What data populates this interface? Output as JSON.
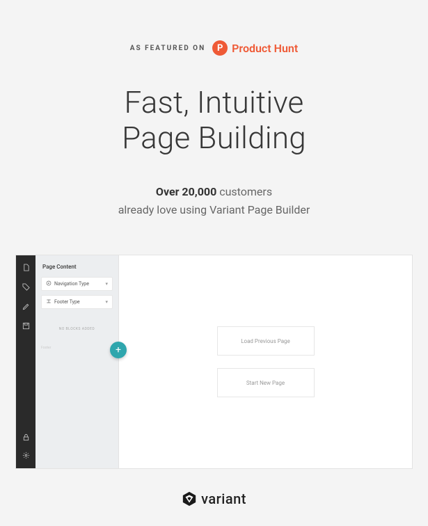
{
  "featured": {
    "label": "AS FEATURED ON",
    "ph_letter": "P",
    "ph_name": "Product Hunt"
  },
  "hero": {
    "line1": "Fast, Intuitive",
    "line2": "Page Building"
  },
  "subhead": {
    "strong": "Over 20,000",
    "rest1": " customers",
    "line2": "already love using Variant Page Builder"
  },
  "mockup": {
    "sidebar_title": "Page Content",
    "nav_type": "Navigation Type",
    "footer_type": "Footer Type",
    "ghost": "NO BLOCKS ADDED",
    "mini_label": "Footer",
    "add_glyph": "+",
    "load_prev": "Load Previous Page",
    "start_new": "Start New Page"
  },
  "brand": {
    "name": "variant"
  },
  "colors": {
    "accent": "#ef5a36",
    "teal": "#2fa6ad",
    "dark": "#2a2a2a"
  }
}
